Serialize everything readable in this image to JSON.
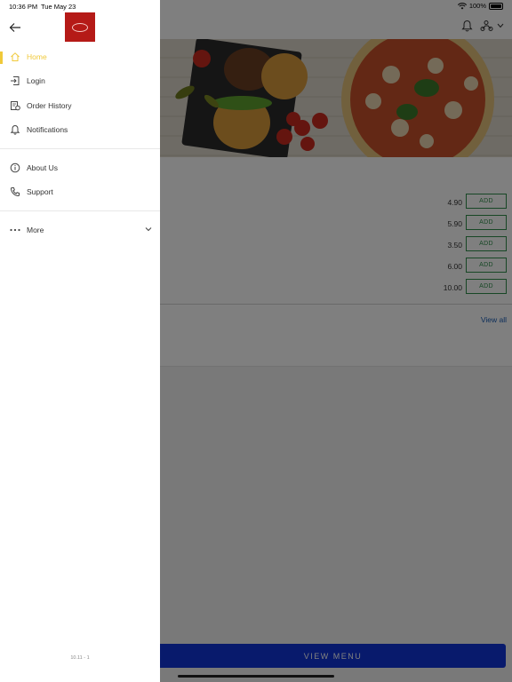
{
  "status_bar": {
    "time": "10:36 PM",
    "date": "Tue May 23",
    "battery": "100%"
  },
  "drawer": {
    "nav_items": [
      {
        "label": "Home",
        "icon": "home-icon",
        "active": true
      },
      {
        "label": "Login",
        "icon": "login-icon",
        "active": false
      },
      {
        "label": "Order History",
        "icon": "order-history-icon",
        "active": false
      },
      {
        "label": "Notifications",
        "icon": "bell-icon",
        "active": false
      }
    ],
    "info_items": [
      {
        "label": "About Us",
        "icon": "info-icon"
      },
      {
        "label": "Support",
        "icon": "phone-icon"
      }
    ],
    "more_label": "More",
    "version": "10.11 - 1",
    "accent_color": "#f0c93a",
    "logo_color": "#b51a17"
  },
  "main": {
    "products": [
      {
        "price": "4.90",
        "button": "ADD"
      },
      {
        "price": "5.90",
        "button": "ADD"
      },
      {
        "price": "3.50",
        "button": "ADD"
      },
      {
        "price": "6.00",
        "button": "ADD"
      },
      {
        "price": "10.00",
        "button": "ADD"
      }
    ],
    "view_all": "View all",
    "view_menu": "VIEW MENU",
    "header_icons": [
      "bell-icon",
      "user-bike-icon",
      "chevron-down-icon"
    ]
  },
  "colors": {
    "add_button": "#2f8f4a",
    "view_menu_bg": "#1034d8",
    "link": "#1a5db4"
  }
}
